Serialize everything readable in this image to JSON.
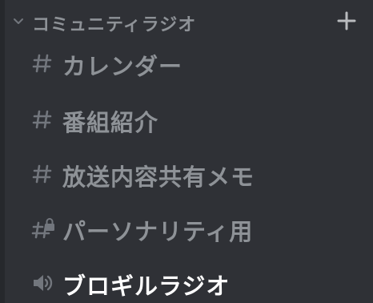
{
  "category": {
    "label": "コミュニティラジオ",
    "collapse_icon": "chevron-down-icon",
    "add_icon": "plus-icon"
  },
  "channels": [
    {
      "label": "カレンダー",
      "icon": "hash-icon",
      "type": "text"
    },
    {
      "label": "番組紹介",
      "icon": "hash-icon",
      "type": "text"
    },
    {
      "label": "放送内容共有メモ",
      "icon": "hash-icon",
      "type": "text"
    },
    {
      "label": "パーソナリティ用",
      "icon": "locked-hash-icon",
      "type": "private-text"
    },
    {
      "label": "ブロギルラジオ",
      "icon": "speaker-icon",
      "type": "voice"
    }
  ],
  "colors": {
    "background": "#2f3136",
    "muted_text": "#8e9297",
    "icon": "#72767d",
    "active_text": "#ffffff"
  }
}
